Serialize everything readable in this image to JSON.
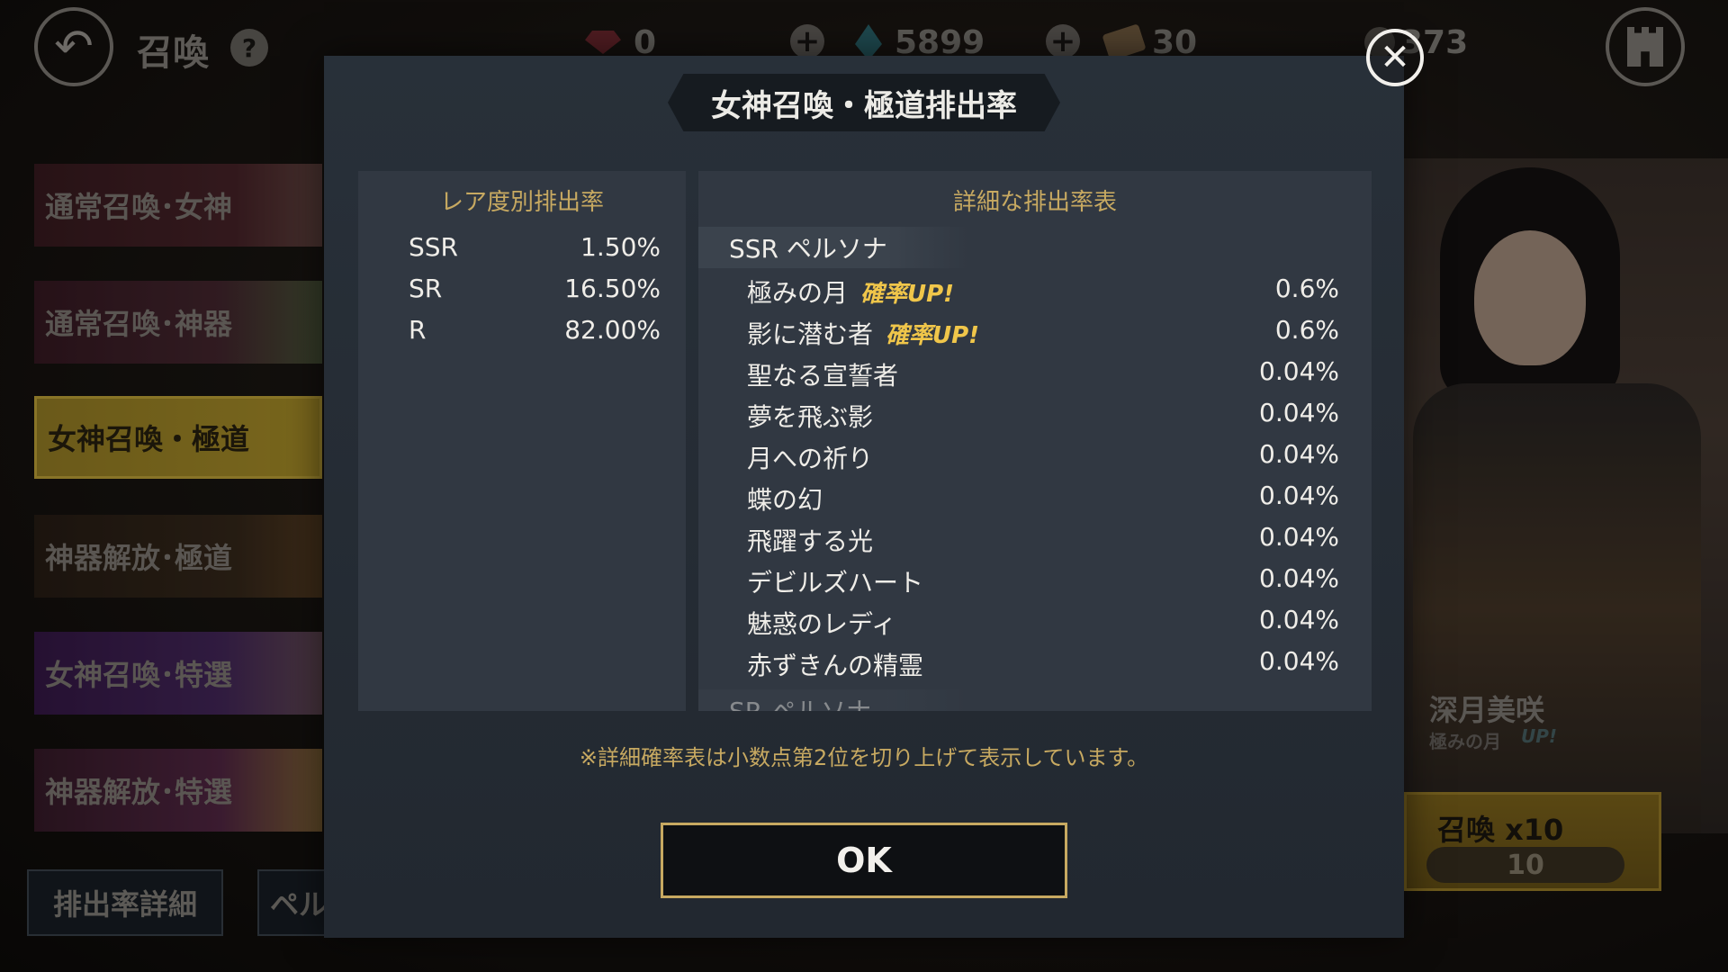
{
  "header": {
    "back_icon": "back-arrow-icon",
    "title": "召喚",
    "help_icon": "?",
    "currencies": [
      {
        "icon": "red-gem-icon",
        "value": "0"
      },
      {
        "icon": "blue-crystal-icon",
        "value": "5899"
      },
      {
        "icon": "ticket-icon",
        "value": "30"
      },
      {
        "icon": "coin-icon",
        "value": "373"
      }
    ],
    "plus_label": "+",
    "castle_icon": "castle-icon"
  },
  "menu": {
    "items": [
      {
        "label": "通常召喚･女神"
      },
      {
        "label": "通常召喚･神器"
      },
      {
        "label": "女神召喚・極道"
      },
      {
        "label": "神器解放･極道"
      },
      {
        "label": "女神召喚･特選"
      },
      {
        "label": "神器解放･特選"
      }
    ]
  },
  "bottom": {
    "rates_button": "排出率詳細",
    "persona_button": "ペル"
  },
  "character": {
    "name": "深月美咲",
    "subtitle": "極みの月",
    "up_badge": "UP!",
    "summon_label": "召喚 x10",
    "summon_cost": "10"
  },
  "modal": {
    "title": "女神召喚・極道排出率",
    "close_label": "✕",
    "rarity_table": {
      "header": "レア度別排出率",
      "rows": [
        {
          "name": "SSR",
          "value": "1.50%"
        },
        {
          "name": "SR",
          "value": "16.50%"
        },
        {
          "name": "R",
          "value": "82.00%"
        }
      ]
    },
    "detail_table": {
      "header": "詳細な排出率表",
      "group_label": "SSR ペルソナ",
      "next_group_label": "SR ペルソナ",
      "rows": [
        {
          "name": "極みの月",
          "up": "確率UP!",
          "value": "0.6%"
        },
        {
          "name": "影に潜む者",
          "up": "確率UP!",
          "value": "0.6%"
        },
        {
          "name": "聖なる宣誓者",
          "value": "0.04%"
        },
        {
          "name": "夢を飛ぶ影",
          "value": "0.04%"
        },
        {
          "name": "月への祈り",
          "value": "0.04%"
        },
        {
          "name": "蝶の幻",
          "value": "0.04%"
        },
        {
          "name": "飛躍する光",
          "value": "0.04%"
        },
        {
          "name": "デビルズハート",
          "value": "0.04%"
        },
        {
          "name": "魅惑のレディ",
          "value": "0.04%"
        },
        {
          "name": "赤ずきんの精霊",
          "value": "0.04%"
        }
      ]
    },
    "note": "※詳細確率表は小数点第2位を切り上げて表示しています。",
    "ok_label": "OK"
  }
}
